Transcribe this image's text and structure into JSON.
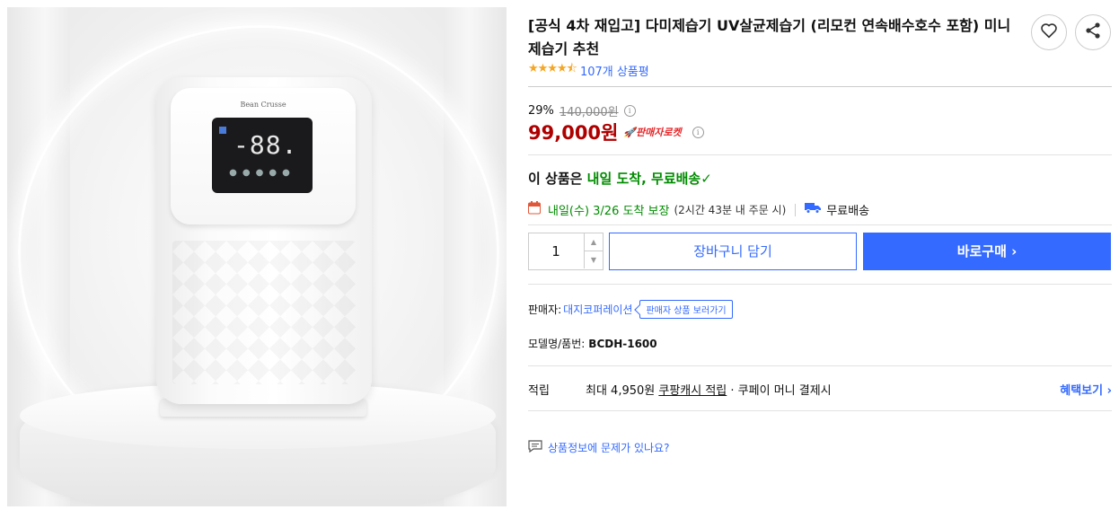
{
  "image": {
    "brand_text": "Bean Crusse",
    "display_digits": "-88.",
    "alt": "다미제습기 UV살균제습기 product image"
  },
  "product": {
    "title": "[공식 4차 재입고] 다미제습기 UV살균제습기 (리모컨 연속배수호수 포함) 미니제습기 추천",
    "rating_stars": 4.5,
    "review_count": "107개 상품평"
  },
  "actions": {
    "wishlist_icon": "heart-icon",
    "share_icon": "share-icon"
  },
  "price": {
    "discount_rate": "29%",
    "original": "140,000원",
    "sale": "99,000원",
    "badge": "판매자로켓"
  },
  "delivery": {
    "headline_prefix": "이 상품은",
    "headline_highlight": "내일 도착, 무료배송",
    "check": "✓",
    "arrive_date": "내일(수) 3/26 도착 보장",
    "arrive_condition": "(2시간 43분 내 주문 시)",
    "free_shipping": "무료배송"
  },
  "purchase": {
    "quantity": "1",
    "cart_label": "장바구니 담기",
    "buy_label": "바로구매 ›"
  },
  "seller": {
    "label": "판매자:",
    "name": "대지코퍼레이션",
    "view_products": "판매자 상품 보러가기"
  },
  "model": {
    "label": "모델명/품번:",
    "value": "BCDH-1600"
  },
  "reward": {
    "label": "적립",
    "max": "최대 4,950원",
    "coupang_cash": "쿠팡캐시 적립",
    "rest": "· 쿠페이 머니 결제시",
    "benefit_link": "혜택보기 ›"
  },
  "report": {
    "text": "상품정보에 문제가 있나요?"
  },
  "colors": {
    "accent": "#346aff",
    "price": "#ae0000",
    "green": "#008c00",
    "star": "#f5a623"
  }
}
